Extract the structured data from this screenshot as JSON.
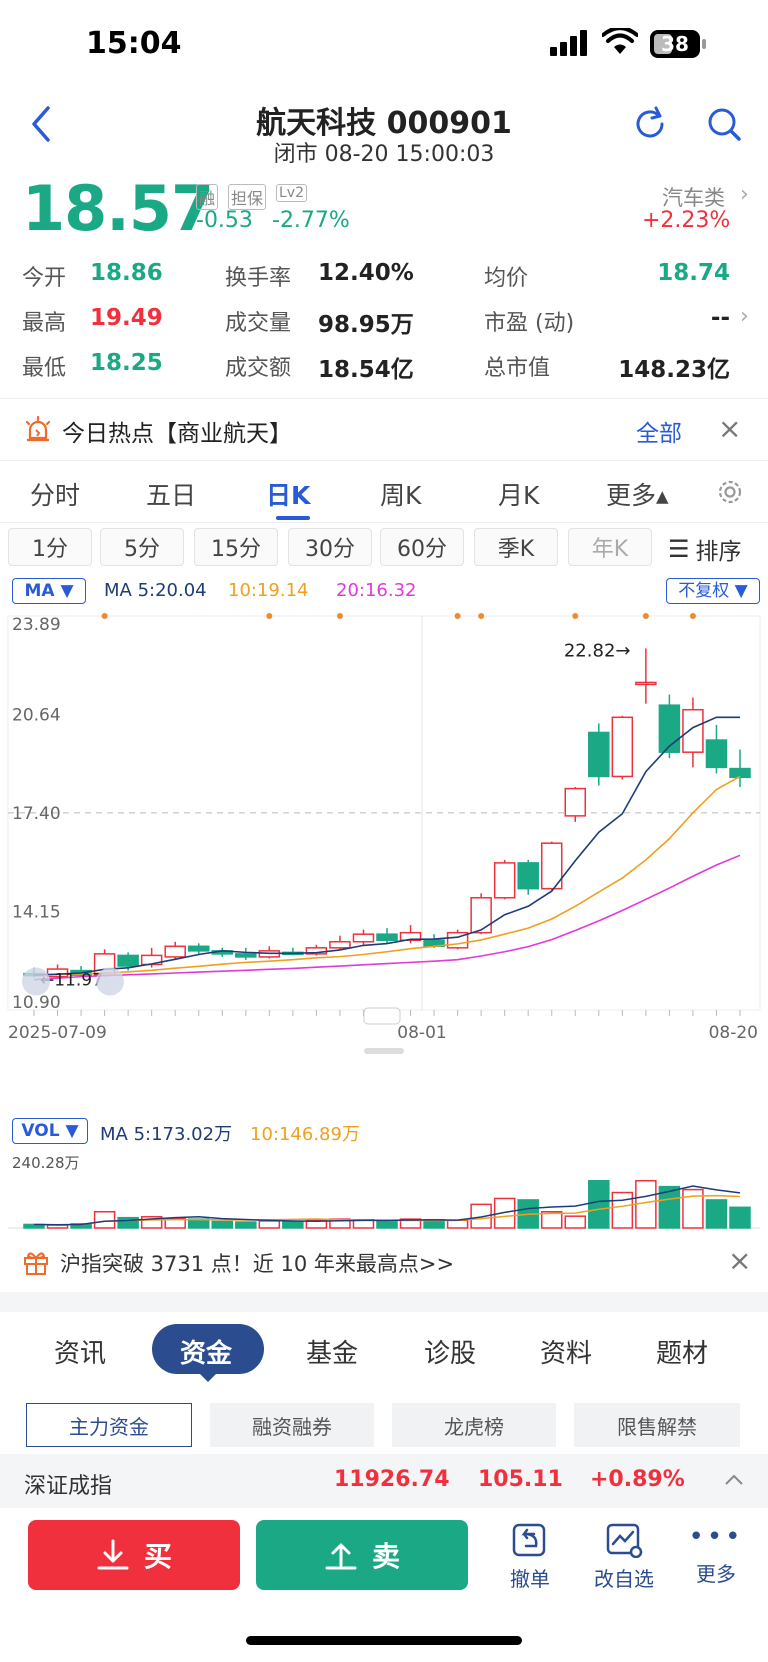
{
  "status_bar": {
    "time": "15:04",
    "battery": "38"
  },
  "header": {
    "title": "航天科技 000901",
    "subtitle": "闭市 08-20 15:00:03"
  },
  "quote": {
    "price": "18.57",
    "badges": [
      "融",
      "担保",
      "Lv2"
    ],
    "change": "-0.53",
    "change_pct": "-2.77%",
    "sector_name": "汽车类",
    "sector_change": "+2.23%"
  },
  "stats": [
    {
      "label": "今开",
      "value": "18.86",
      "color": "#1aa885"
    },
    {
      "label": "换手率",
      "value": "12.40%",
      "color": "#222222"
    },
    {
      "label": "均价",
      "value": "18.74",
      "color": "#1aa885"
    },
    {
      "label": "最高",
      "value": "19.49",
      "color": "#f0313d"
    },
    {
      "label": "成交量",
      "value": "98.95万",
      "color": "#222222"
    },
    {
      "label": "市盈 (动)",
      "value": "--",
      "color": "#222222"
    },
    {
      "label": "最低",
      "value": "18.25",
      "color": "#1aa885"
    },
    {
      "label": "成交额",
      "value": "18.54亿",
      "color": "#222222"
    },
    {
      "label": "总市值",
      "value": "148.23亿",
      "color": "#222222"
    }
  ],
  "hot": {
    "text": "今日热点【商业航天】",
    "all_label": "全部"
  },
  "period_tabs": [
    {
      "label": "分时",
      "active": false
    },
    {
      "label": "五日",
      "active": false
    },
    {
      "label": "日K",
      "active": true
    },
    {
      "label": "周K",
      "active": false
    },
    {
      "label": "月K",
      "active": false
    },
    {
      "label": "更多▴",
      "active": false
    }
  ],
  "minute_tabs": [
    "1分",
    "5分",
    "15分",
    "30分",
    "60分",
    "季K",
    "年K"
  ],
  "sort_label": "排序",
  "ma_bar": {
    "selector": "MA ▼",
    "ma5": "MA 5:20.04",
    "ma10": "10:19.14",
    "ma20": "20:16.32",
    "adjust": "不复权 ▼"
  },
  "chart_data": {
    "type": "candlestick",
    "y_ticks": [
      "23.89",
      "20.64",
      "17.40",
      "14.15",
      "10.90"
    ],
    "ylim": [
      10.9,
      23.89
    ],
    "x_labels": [
      "2025-07-09",
      "08-01",
      "08-20"
    ],
    "annotations": [
      "22.82→",
      "←11.97"
    ],
    "candles": [
      {
        "o": 12.1,
        "c": 12.05,
        "h": 12.3,
        "l": 11.97
      },
      {
        "o": 12.0,
        "c": 12.25,
        "h": 12.4,
        "l": 11.95
      },
      {
        "o": 12.2,
        "c": 12.05,
        "h": 12.35,
        "l": 11.99
      },
      {
        "o": 12.05,
        "c": 12.75,
        "h": 12.9,
        "l": 12.0
      },
      {
        "o": 12.7,
        "c": 12.35,
        "h": 12.8,
        "l": 12.2
      },
      {
        "o": 12.4,
        "c": 12.7,
        "h": 12.95,
        "l": 12.3
      },
      {
        "o": 12.65,
        "c": 13.0,
        "h": 13.15,
        "l": 12.55
      },
      {
        "o": 13.0,
        "c": 12.85,
        "h": 13.1,
        "l": 12.75
      },
      {
        "o": 12.85,
        "c": 12.75,
        "h": 12.95,
        "l": 12.65
      },
      {
        "o": 12.75,
        "c": 12.65,
        "h": 12.95,
        "l": 12.55
      },
      {
        "o": 12.65,
        "c": 12.85,
        "h": 13.0,
        "l": 12.6
      },
      {
        "o": 12.8,
        "c": 12.75,
        "h": 12.95,
        "l": 12.7
      },
      {
        "o": 12.75,
        "c": 12.95,
        "h": 13.05,
        "l": 12.7
      },
      {
        "o": 12.95,
        "c": 13.15,
        "h": 13.35,
        "l": 12.9
      },
      {
        "o": 13.15,
        "c": 13.4,
        "h": 13.55,
        "l": 13.05
      },
      {
        "o": 13.4,
        "c": 13.2,
        "h": 13.6,
        "l": 13.1
      },
      {
        "o": 13.2,
        "c": 13.45,
        "h": 13.7,
        "l": 13.1
      },
      {
        "o": 13.2,
        "c": 13.0,
        "h": 13.4,
        "l": 12.95
      },
      {
        "o": 12.95,
        "c": 13.45,
        "h": 13.55,
        "l": 12.9
      },
      {
        "o": 13.45,
        "c": 14.6,
        "h": 14.75,
        "l": 13.4
      },
      {
        "o": 14.6,
        "c": 15.75,
        "h": 15.85,
        "l": 14.55
      },
      {
        "o": 15.75,
        "c": 14.9,
        "h": 15.85,
        "l": 14.7
      },
      {
        "o": 14.9,
        "c": 16.4,
        "h": 16.45,
        "l": 14.85
      },
      {
        "o": 17.3,
        "c": 18.2,
        "h": 18.25,
        "l": 17.1
      },
      {
        "o": 20.05,
        "c": 18.6,
        "h": 20.35,
        "l": 18.3
      },
      {
        "o": 18.6,
        "c": 20.55,
        "h": 20.6,
        "l": 18.5
      },
      {
        "o": 21.7,
        "c": 21.7,
        "h": 22.82,
        "l": 21.0
      },
      {
        "o": 20.95,
        "c": 19.4,
        "h": 21.3,
        "l": 19.2
      },
      {
        "o": 19.4,
        "c": 20.8,
        "h": 21.2,
        "l": 18.9
      },
      {
        "o": 19.8,
        "c": 18.9,
        "h": 20.3,
        "l": 18.7
      },
      {
        "o": 18.86,
        "c": 18.57,
        "h": 19.49,
        "l": 18.25
      }
    ],
    "ma5": [
      12.05,
      12.08,
      12.12,
      12.24,
      12.29,
      12.42,
      12.57,
      12.73,
      12.85,
      12.8,
      12.77,
      12.77,
      12.79,
      12.88,
      13.03,
      13.09,
      13.23,
      13.24,
      13.3,
      13.54,
      14.04,
      14.32,
      14.82,
      15.82,
      16.76,
      17.37,
      18.76,
      19.6,
      20.21,
      20.55,
      20.55,
      20.04
    ],
    "ma10": [
      12.05,
      12.07,
      12.09,
      12.12,
      12.16,
      12.21,
      12.28,
      12.34,
      12.41,
      12.47,
      12.51,
      12.56,
      12.62,
      12.66,
      12.73,
      12.82,
      12.92,
      13.0,
      13.08,
      13.21,
      13.4,
      13.6,
      13.9,
      14.32,
      14.79,
      15.25,
      15.85,
      16.55,
      17.4,
      18.17,
      18.6,
      19.14
    ],
    "ma20": [
      11.9,
      11.95,
      12.0,
      12.03,
      12.06,
      12.09,
      12.12,
      12.15,
      12.18,
      12.21,
      12.24,
      12.27,
      12.31,
      12.35,
      12.39,
      12.43,
      12.47,
      12.51,
      12.56,
      12.68,
      12.82,
      12.99,
      13.22,
      13.52,
      13.84,
      14.18,
      14.55,
      14.92,
      15.31,
      15.68,
      16.0,
      16.32
    ]
  },
  "vol_bar": {
    "selector": "VOL ▼",
    "ma5": "MA 5:173.02万",
    "ma10": "10:146.89万",
    "max": "240.28万"
  },
  "volume_data": [
    12,
    10,
    14,
    55,
    35,
    38,
    33,
    30,
    22,
    20,
    24,
    22,
    26,
    30,
    28,
    22,
    30,
    28,
    26,
    80,
    100,
    95,
    55,
    40,
    160,
    120,
    160,
    140,
    130,
    95,
    70
  ],
  "news": {
    "text": "沪指突破 3731 点！近 10 年来最高点>>"
  },
  "info_tabs": [
    {
      "label": "资讯",
      "active": false
    },
    {
      "label": "资金",
      "active": true
    },
    {
      "label": "基金",
      "active": false
    },
    {
      "label": "诊股",
      "active": false
    },
    {
      "label": "资料",
      "active": false
    },
    {
      "label": "题材",
      "active": false
    }
  ],
  "seg_tabs": [
    "主力资金",
    "融资融券",
    "龙虎榜",
    "限售解禁"
  ],
  "index_bar": {
    "name": "深证成指",
    "value": "11926.74",
    "change": "105.11",
    "pct": "+0.89%"
  },
  "bottom": {
    "buy": "买",
    "sell": "卖",
    "cancel": "撤单",
    "watch": "改自选",
    "more": "更多"
  }
}
